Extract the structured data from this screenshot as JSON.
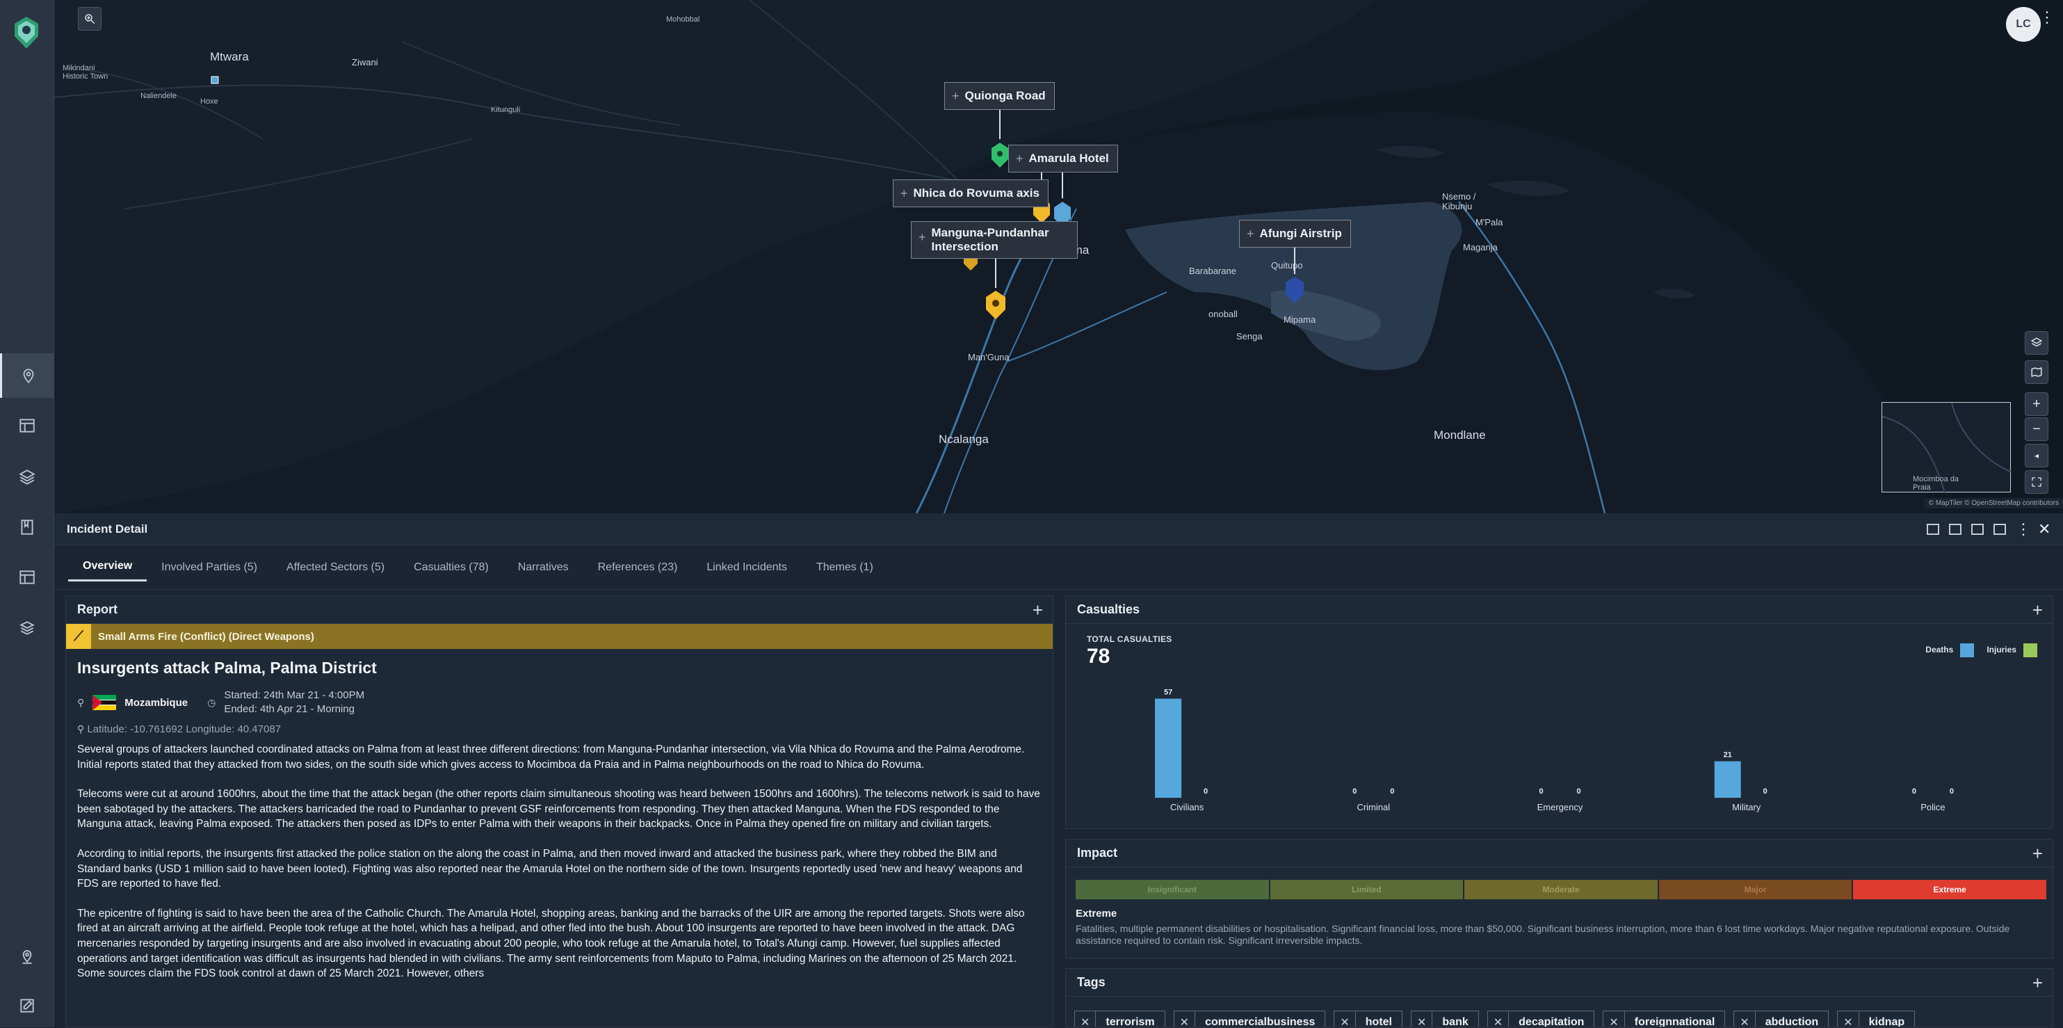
{
  "sidebar": {
    "items": [
      {
        "name": "map-pin-icon",
        "active": true
      },
      {
        "name": "dashboard-icon",
        "active": false
      },
      {
        "name": "layers-icon",
        "active": false
      },
      {
        "name": "book-icon",
        "active": false
      },
      {
        "name": "table-icon",
        "active": false
      },
      {
        "name": "stack-icon",
        "active": false
      },
      {
        "name": "location-icon",
        "active": false
      },
      {
        "name": "edit-icon",
        "active": false
      }
    ]
  },
  "user": {
    "initials": "LC"
  },
  "map": {
    "labels": [
      {
        "text": "Mtwara",
        "cls": "big"
      },
      {
        "text": "Ziwani",
        "cls": ""
      },
      {
        "text": "Mikindani Historic Town",
        "cls": "small"
      },
      {
        "text": "Naliendele",
        "cls": "small"
      },
      {
        "text": "Hoxe",
        "cls": "small"
      },
      {
        "text": "Kitunguli",
        "cls": "small"
      },
      {
        "text": "Mohobbal",
        "cls": "small"
      },
      {
        "text": "Barabarane",
        "cls": ""
      },
      {
        "text": "onoball",
        "cls": ""
      },
      {
        "text": "Senga",
        "cls": ""
      },
      {
        "text": "Mipama",
        "cls": ""
      },
      {
        "text": "Quitupo",
        "cls": ""
      },
      {
        "text": "Palma",
        "cls": "big"
      },
      {
        "text": "Man'Guna",
        "cls": ""
      },
      {
        "text": "Nsemo / Kibunju",
        "cls": ""
      },
      {
        "text": "M'Pala",
        "cls": ""
      },
      {
        "text": "Maganja",
        "cls": ""
      },
      {
        "text": "Ncalanga",
        "cls": "big"
      },
      {
        "text": "Mondlane",
        "cls": "big"
      },
      {
        "text": "Mocimboa da Praia",
        "cls": "small"
      }
    ],
    "callouts": [
      {
        "label": "Quionga Road"
      },
      {
        "label": "Amarula Hotel"
      },
      {
        "label": "Nhica do Rovuma axis"
      },
      {
        "label": "Manguna-Pundanhar Intersection"
      },
      {
        "label": "Afungi Airstrip"
      }
    ],
    "attribution": "© MapTiler © OpenStreetMap contributors",
    "zoom_in": "+",
    "zoom_out": "−"
  },
  "panel": {
    "title": "Incident Detail",
    "tabs": [
      {
        "label": "Overview",
        "active": true
      },
      {
        "label": "Involved Parties (5)"
      },
      {
        "label": "Affected Sectors (5)"
      },
      {
        "label": "Casualties (78)"
      },
      {
        "label": "Narratives"
      },
      {
        "label": "References (23)"
      },
      {
        "label": "Linked Incidents"
      },
      {
        "label": "Themes (1)"
      }
    ]
  },
  "report": {
    "section_title": "Report",
    "category": "Small Arms Fire (Conflict) (Direct Weapons)",
    "title": "Insurgents attack Palma, Palma District",
    "country": "Mozambique",
    "started": "Started: 24th Mar 21 - 4:00PM",
    "ended": "Ended: 4th Apr 21 - Morning",
    "coordinates": "Latitude: -10.761692 Longitude: 40.47087",
    "paragraphs": [
      "Several groups of attackers launched coordinated attacks on Palma from at least three different directions: from Manguna-Pundanhar intersection, via Vila Nhica do Rovuma and the Palma Aerodrome. Initial reports stated that they attacked from two sides, on the south side which gives access to Mocimboa da Praia and in Palma neighbourhoods on the road to Nhica do Rovuma.",
      "Telecoms were cut at around 1600hrs, about the time that the attack began (the other reports claim simultaneous shooting was heard between 1500hrs and 1600hrs). The telecoms network is said to have been sabotaged by the attackers. The attackers barricaded the road to Pundanhar to prevent GSF reinforcements from responding. They then attacked Manguna. When the FDS responded to the Manguna attack, leaving Palma exposed. The attackers then posed as IDPs to enter Palma with their weapons in their backpacks. Once in Palma they opened fire on military and civilian targets.",
      "According to initial reports, the insurgents first attacked the police station on the along the coast in Palma, and then moved inward and attacked the business park, where they robbed the BIM and Standard banks (USD 1 million said to have been looted). Fighting was also reported near the Amarula Hotel on the northern side of the town. Insurgents reportedly used 'new and heavy' weapons and FDS are reported to have fled.",
      "The epicentre of fighting is said to have been the area of the Catholic Church. The Amarula Hotel, shopping areas, banking and the barracks of the UIR are among the reported targets. Shots were also fired at an aircraft arriving at the airfield. People took refuge at the hotel, which has a helipad, and other fled into the bush. About 100 insurgents are reported to have been involved in the attack. DAG mercenaries responded by targeting insurgents and are also involved in evacuating about 200 people, who took refuge at the Amarula hotel, to Total's Afungi camp. However, fuel supplies affected operations and target identification was difficult as insurgents had blended in with civilians. The army sent reinforcements from Maputo to Palma, including Marines on the afternoon of 25 March 2021. Some sources claim the FDS took control at dawn of 25 March 2021. However, others"
    ]
  },
  "casualties": {
    "section_title": "Casualties",
    "total_label": "TOTAL CASUALTIES",
    "total_value": "78",
    "legend": [
      {
        "label": "Deaths",
        "color": "#56a8dc"
      },
      {
        "label": "Injuries",
        "color": "#9bc85a"
      }
    ]
  },
  "chart_data": {
    "type": "bar",
    "title": "TOTAL CASUALTIES",
    "categories": [
      "Civilians",
      "Criminal",
      "Emergency",
      "Military",
      "Police"
    ],
    "series": [
      {
        "name": "Deaths",
        "values": [
          57,
          0,
          0,
          21,
          0
        ],
        "color": "#56a8dc"
      },
      {
        "name": "Injuries",
        "values": [
          0,
          0,
          0,
          0,
          0
        ],
        "color": "#9bc85a"
      }
    ],
    "ylim": [
      0,
      60
    ],
    "grid": false,
    "legend": "top-right"
  },
  "impact": {
    "section_title": "Impact",
    "scale": [
      {
        "label": "Insignificant",
        "bg": "#4d6a3c",
        "fg": "#7c9867"
      },
      {
        "label": "Limited",
        "bg": "#5b6b35",
        "fg": "#8f9b66"
      },
      {
        "label": "Moderate",
        "bg": "#6e6a2d",
        "fg": "#a39d5c"
      },
      {
        "label": "Major",
        "bg": "#7a4a20",
        "fg": "#b07a4c"
      },
      {
        "label": "Extreme",
        "bg": "#e03b2f",
        "fg": "#ffffff"
      }
    ],
    "level": "Extreme",
    "description": "Fatalities, multiple permanent disabilities or hospitalisation. Significant financial loss, more than $50,000. Significant business interruption, more than 6 lost time workdays. Major negative reputational exposure. Outside assistance required to contain risk. Significant irreversible impacts."
  },
  "tags": {
    "section_title": "Tags",
    "items": [
      "terrorism",
      "commercialbusiness",
      "hotel",
      "bank",
      "decapitation",
      "foreignnational",
      "abduction",
      "kidnap"
    ]
  }
}
